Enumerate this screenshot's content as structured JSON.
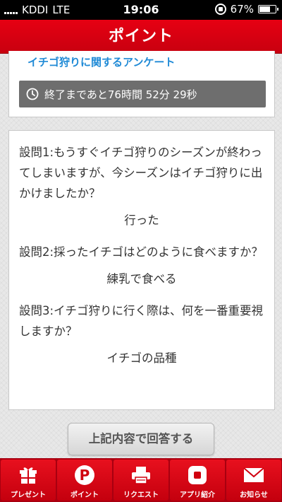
{
  "status_bar": {
    "carrier": "KDDI",
    "network": "LTE",
    "time": "19:06",
    "battery": "67%",
    "battery_level": 0.67
  },
  "header": {
    "title": "ポイント"
  },
  "survey": {
    "title": "イチゴ狩りに関するアンケート",
    "timer_text": "終了まであと76時間 52分 29秒"
  },
  "questions": [
    {
      "question": "設問1:もうすぐイチゴ狩りのシーズンが終わってしまいますが、今シーズンはイチゴ狩りに出かけましたか？",
      "answer": "行った"
    },
    {
      "question": "設問2:採ったイチゴはどのように食べますか？",
      "answer": "練乳で食べる"
    },
    {
      "question": "設問3:イチゴ狩りに行く際は、何を一番重要視しますか？",
      "answer": "イチゴの品種"
    }
  ],
  "submit_label": "上記内容で回答する",
  "tabs": [
    {
      "label": "プレゼント",
      "icon": "gift-icon"
    },
    {
      "label": "ポイント",
      "icon": "point-icon"
    },
    {
      "label": "リクエスト",
      "icon": "printer-icon"
    },
    {
      "label": "アプリ紹介",
      "icon": "app-icon"
    },
    {
      "label": "お知らせ",
      "icon": "mail-icon"
    }
  ],
  "colors": {
    "brand_red": "#e60012",
    "link_blue": "#1f8ad6",
    "timer_gray": "#6e6e6e"
  }
}
